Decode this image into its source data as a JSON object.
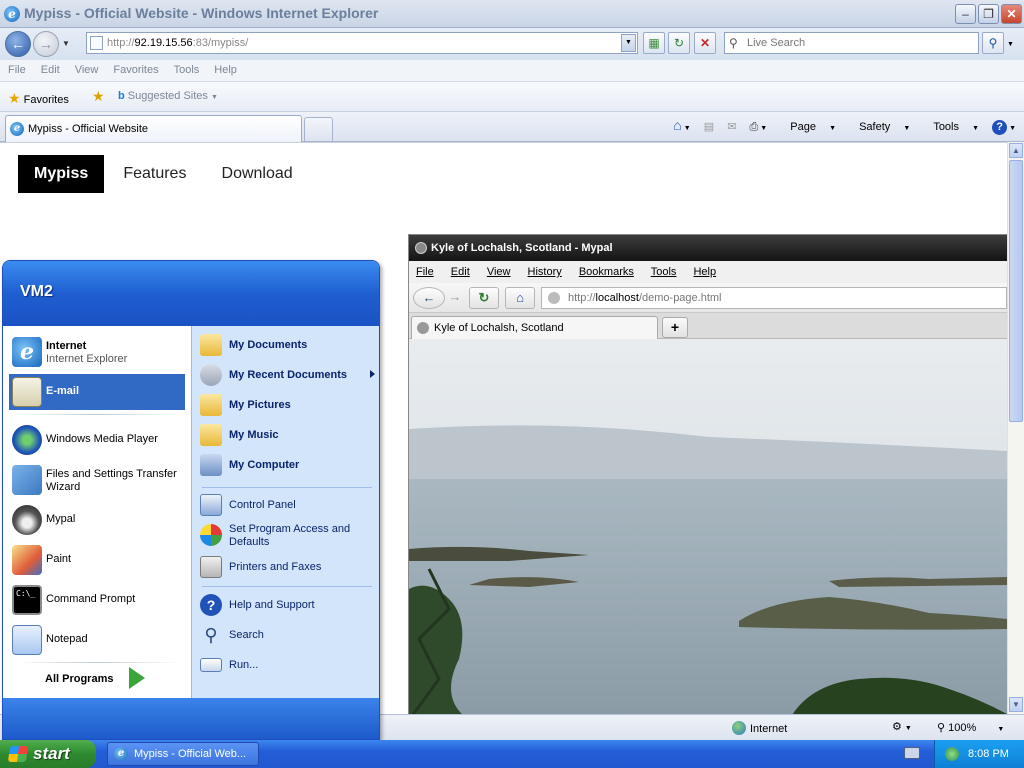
{
  "ie": {
    "window_title": "Mypiss - Official Website - Windows Internet Explorer",
    "address_prefix": "http://",
    "address_host": "92.19.15.56",
    "address_rest": ":83/mypiss/",
    "search_placeholder": "Live Search",
    "menu": [
      "File",
      "Edit",
      "View",
      "Favorites",
      "Tools",
      "Help"
    ],
    "favorites_label": "Favorites",
    "suggested_sites": "Suggested Sites",
    "tab_title": "Mypiss - Official Website",
    "cmd": {
      "page": "Page",
      "safety": "Safety",
      "tools": "Tools"
    },
    "status_zone": "Internet",
    "zoom": "100%"
  },
  "site": {
    "nav": [
      {
        "label": "Mypiss",
        "active": true
      },
      {
        "label": "Features",
        "active": false
      },
      {
        "label": "Download",
        "active": false
      }
    ]
  },
  "mypal": {
    "title": "Kyle of Lochalsh, Scotland - Mypal",
    "menu": [
      "File",
      "Edit",
      "View",
      "History",
      "Bookmarks",
      "Tools",
      "Help"
    ],
    "url_prefix": "http://",
    "url_host": "localhost",
    "url_rest": "/demo-page.html",
    "tab_title": "Kyle of Lochalsh, Scotland",
    "newtab_symbol": "+"
  },
  "startmenu": {
    "user": "VM2",
    "left": {
      "internet_title": "Internet",
      "internet_sub": "Internet Explorer",
      "email": "E-mail",
      "wmp": "Windows Media Player",
      "transfer": "Files and Settings Transfer Wizard",
      "mypal": "Mypal",
      "paint": "Paint",
      "cmd": "Command Prompt",
      "notepad": "Notepad",
      "all_programs": "All Programs"
    },
    "right": {
      "docs": "My Documents",
      "recent": "My Recent Documents",
      "pictures": "My Pictures",
      "music": "My Music",
      "computer": "My Computer",
      "control": "Control Panel",
      "spad": "Set Program Access and Defaults",
      "printers": "Printers and Faxes",
      "help": "Help and Support",
      "search": "Search",
      "run": "Run..."
    }
  },
  "taskbar": {
    "start": "start",
    "task_ie": "Mypiss - Official Web...",
    "clock": "8:08 PM"
  }
}
